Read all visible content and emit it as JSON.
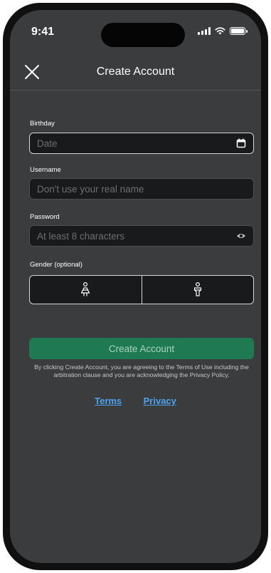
{
  "status_bar": {
    "time": "9:41"
  },
  "header": {
    "title": "Create Account"
  },
  "form": {
    "birthday": {
      "label": "Birthday",
      "placeholder": "Date"
    },
    "username": {
      "label": "Username",
      "placeholder": "Don't use your real name"
    },
    "password": {
      "label": "Password",
      "placeholder": "At least 8 characters"
    },
    "gender": {
      "label": "Gender (optional)",
      "options": [
        "female",
        "male"
      ]
    }
  },
  "actions": {
    "create_label": "Create Account"
  },
  "legal": {
    "text": "By clicking Create Account, you are agreeing to the Terms of Use including the arbitration clause and you are acknowledging the Privacy Policy.",
    "terms_link": "Terms",
    "privacy_link": "Privacy"
  },
  "colors": {
    "background": "#3b3c3e",
    "field_bg": "#191a1c",
    "accent_green": "#1f7a52",
    "link_blue": "#4ea3f1"
  }
}
